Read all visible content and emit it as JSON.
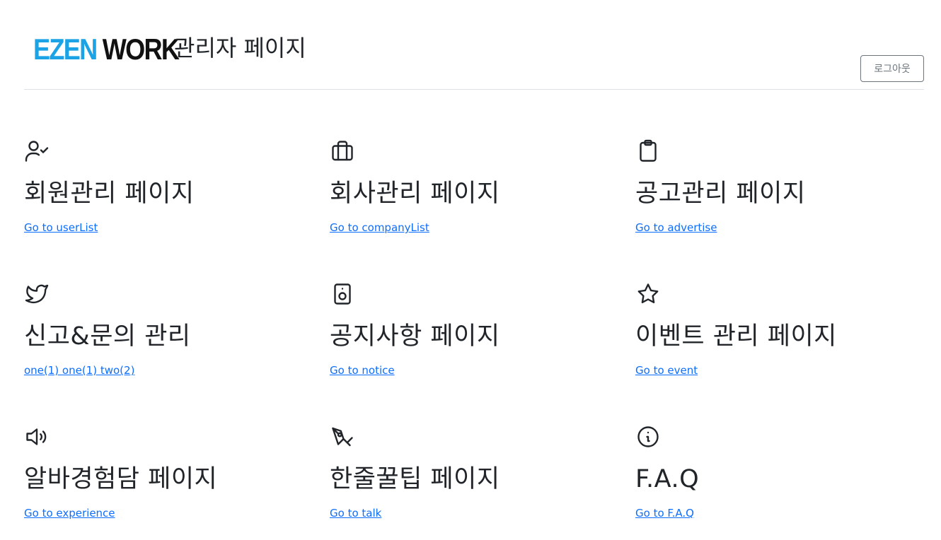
{
  "header": {
    "logo_part1": "EZEN",
    "logo_part2": "WORK",
    "title": "관리자 페이지",
    "logout_label": "로그아웃"
  },
  "colors": {
    "logo_blue": "#1ba3e6",
    "link": "#0d6efd",
    "text": "#212529",
    "button_border": "#6c757d"
  },
  "cards": [
    {
      "icon": "user-check-icon",
      "title": "회원관리 페이지",
      "link": "Go to userList "
    },
    {
      "icon": "briefcase-icon",
      "title": "회사관리 페이지",
      "link": "Go to companyList "
    },
    {
      "icon": "clipboard-icon",
      "title": "공고관리 페이지",
      "link": "Go to advertise "
    },
    {
      "icon": "twitter-icon",
      "title": "신고&문의 관리",
      "link": "one(1) one(1) two(2) "
    },
    {
      "icon": "speaker-icon",
      "title": "공지사항 페이지",
      "link": "Go to notice "
    },
    {
      "icon": "star-icon",
      "title": "이벤트 관리 페이지",
      "link": "Go to event "
    },
    {
      "icon": "volume-icon",
      "title": "알바경험담 페이지",
      "link": "Go to experience "
    },
    {
      "icon": "pen-tool-icon",
      "title": "한줄꿀팁 페이지",
      "link": "Go to talk "
    },
    {
      "icon": "info-icon",
      "title": "F.A.Q",
      "link": "Go to F.A.Q "
    }
  ]
}
